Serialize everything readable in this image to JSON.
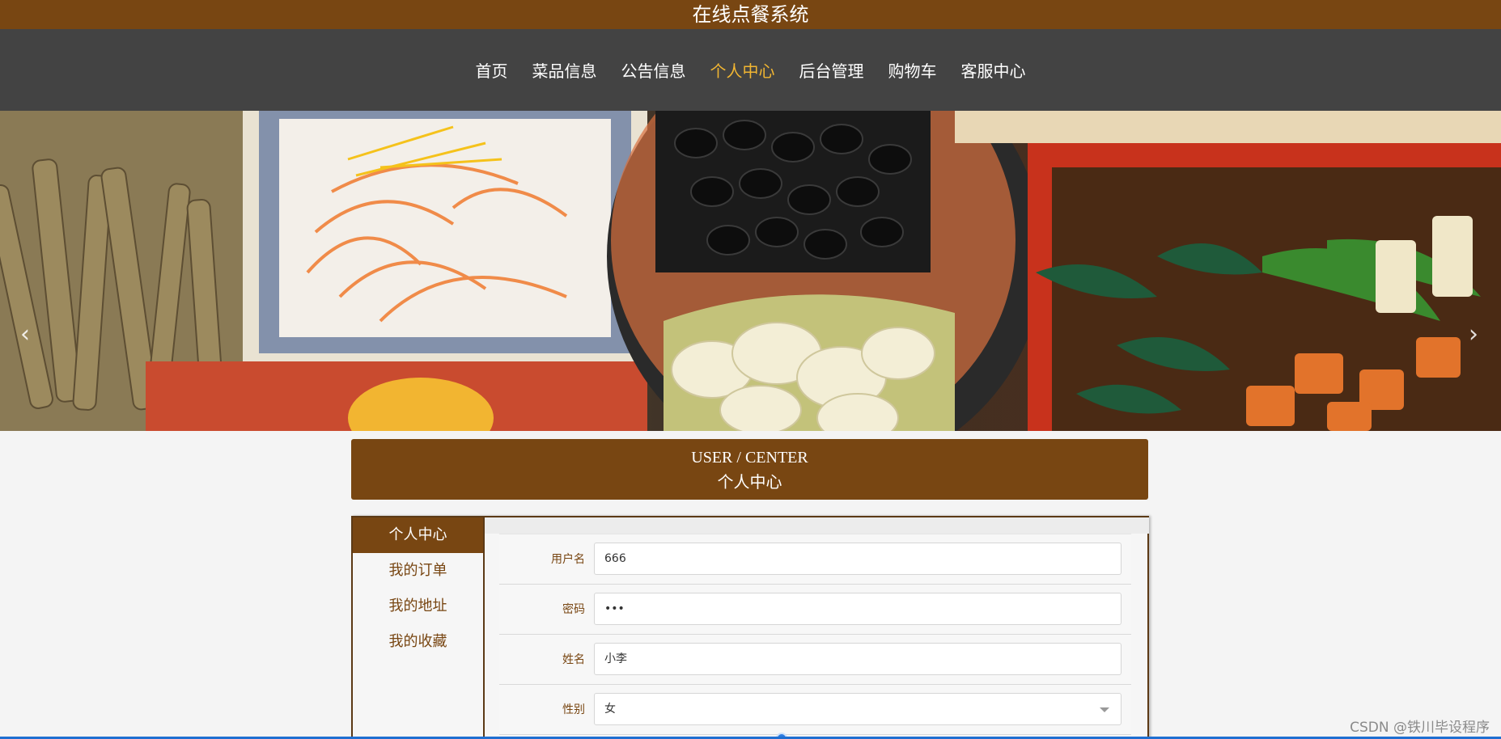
{
  "site": {
    "title": "在线点餐系统"
  },
  "nav": {
    "items": [
      {
        "label": "首页"
      },
      {
        "label": "菜品信息"
      },
      {
        "label": "公告信息"
      },
      {
        "label": "个人中心",
        "active": true
      },
      {
        "label": "后台管理"
      },
      {
        "label": "购物车"
      },
      {
        "label": "客服中心"
      }
    ]
  },
  "carousel": {
    "prev_icon": "‹",
    "next_icon": "›",
    "dot_count": 3,
    "active_dot": 1
  },
  "center": {
    "title_en": "USER / CENTER",
    "title_zh": "个人中心"
  },
  "sidebar": {
    "items": [
      {
        "label": "个人中心",
        "active": true
      },
      {
        "label": "我的订单"
      },
      {
        "label": "我的地址"
      },
      {
        "label": "我的收藏"
      }
    ]
  },
  "form": {
    "username": {
      "label": "用户名",
      "value": "666"
    },
    "password": {
      "label": "密码",
      "value": "•••"
    },
    "name": {
      "label": "姓名",
      "value": "小李"
    },
    "gender": {
      "label": "性别",
      "value": "女"
    }
  },
  "watermark": "CSDN @铁川毕设程序",
  "colors": {
    "brand": "#784612",
    "nav_bg": "#434343",
    "nav_active": "#f2b632"
  }
}
